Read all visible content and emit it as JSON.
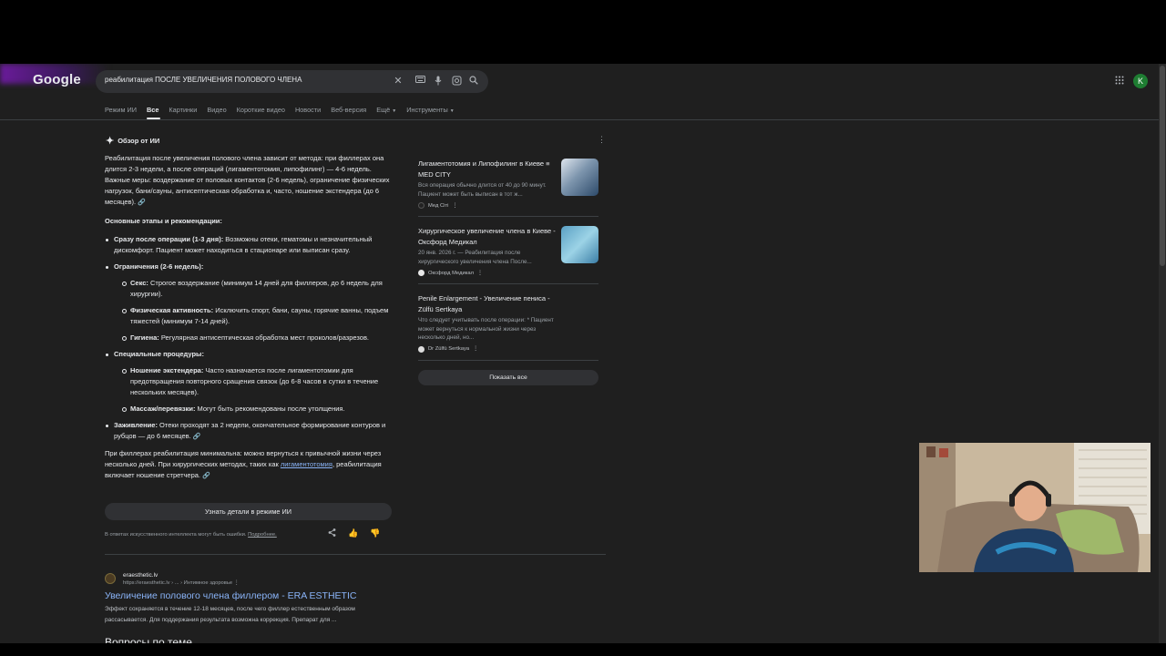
{
  "header": {
    "logo": "Google",
    "search": {
      "query": "реабилитация ПОСЛЕ УВЕЛИЧЕНИЯ ПОЛОВОГО ЧЛЕНА"
    },
    "icons": {
      "clear": "close-icon",
      "keyboard": "keyboard-icon",
      "voice": "mic-icon",
      "lens": "lens-icon",
      "search": "search-icon",
      "apps": "apps-grid-icon"
    },
    "avatar_letter": "K"
  },
  "tabs": [
    {
      "label": "Режим ИИ"
    },
    {
      "label": "Все",
      "active": true
    },
    {
      "label": "Картинки"
    },
    {
      "label": "Видео"
    },
    {
      "label": "Короткие видео"
    },
    {
      "label": "Новости"
    },
    {
      "label": "Веб-версия"
    },
    {
      "label": "Ещё"
    },
    {
      "label": "Инструменты"
    }
  ],
  "ai_overview": {
    "title": "Обзор от ИИ",
    "intro": "Реабилитация после увеличения полового члена зависит от метода: при филлерах она длится 2-3 недели, а после операций (лигаментотомия, липофилинг) — 4-6 недель. Важные меры: воздержание от половых контактов (2-6 недель), ограничение физических нагрузок, бани/сауны, антисептическая обработка и, часто, ношение экстендера (до 6 месяцев).",
    "heading": "Основные этапы и рекомендации:",
    "stage1_title": "Сразу после операции (1-3 дня):",
    "stage1_text": " Возможны отеки, гематомы и незначительный дискомфорт. Пациент может находиться в стационаре или выписан сразу.",
    "stage2_title": "Ограничения (2-6 недель):",
    "sex_title": "Секс:",
    "sex_text": " Строгое воздержание (минимум 14 дней для филлеров, до 6 недель для хирургии).",
    "phys_title": "Физическая активность:",
    "phys_text": " Исключить спорт, бани, сауны, горячие ванны, подъем тяжестей (минимум 7-14 дней).",
    "hyg_title": "Гигиена:",
    "hyg_text": " Регулярная антисептическая обработка мест проколов/разрезов.",
    "stage3_title": "Специальные процедуры:",
    "ext_title": "Ношение экстендера:",
    "ext_text": " Часто назначается после лигаментотомии для предотвращения повторного сращения связок (до 6-8 часов в сутки в течение нескольких месяцев).",
    "mass_title": "Массаж/перевязки:",
    "mass_text": " Могут быть рекомендованы после утолщения.",
    "stage4_title": "Заживление:",
    "stage4_text": " Отеки проходят за 2 недели, окончательное формирование контуров и рубцов — до 6 месяцев.",
    "outro_a": "При филлерах реабилитация минимальна: можно вернуться к привычной жизни через несколько дней. При хирургических методах, таких как ",
    "outro_link": "лигаментотомия",
    "outro_b": ", реабилитация включает ношение стретчера.",
    "ai_button": "Узнать детали в режиме ИИ",
    "disclaimer": "В ответах искусственного интеллекта могут быть ошибки.",
    "disclaimer_link": "Подробнее.",
    "sources": [
      {
        "title": "Лигаментотомия и Липофилинг в Киеве ≡ MED CITY",
        "snippet": "Вся операция обычно длится от 40 до 90 минут. Пациент может быть выписан в тот ж...",
        "source": "Мед Сіті"
      },
      {
        "title": "Хирургическое увеличение члена в Киеве - Оксфорд Медикал",
        "snippet": "20 янв. 2026 г. — Реабилитация после хирургического увеличения члена После...",
        "source": "Оксфорд Медикал"
      },
      {
        "title": "Penile Enlargement - Увеличение пениса - Zülfü Sertkaya",
        "snippet": "Что следует учитывать после операции: * Пациент может вернуться к нормальной жизни через несколько дней, но...",
        "source": "Dr Zülfü Sertkaya"
      }
    ],
    "show_all": "Показать все"
  },
  "result": {
    "site": "eraesthetic.lv",
    "url": "https://eraesthetic.lv › ... › Интимное здоровье",
    "title": "Увеличение полового члена филлером - ERA ESTHETIC",
    "snippet": "Эффект сохраняется в течение 12-18 месяцев, после чего филлер естественным образом рассасывается. Для поддержания результата возможна коррекция. Препарат для ...",
    "next_heading": "Вопросы по теме"
  }
}
